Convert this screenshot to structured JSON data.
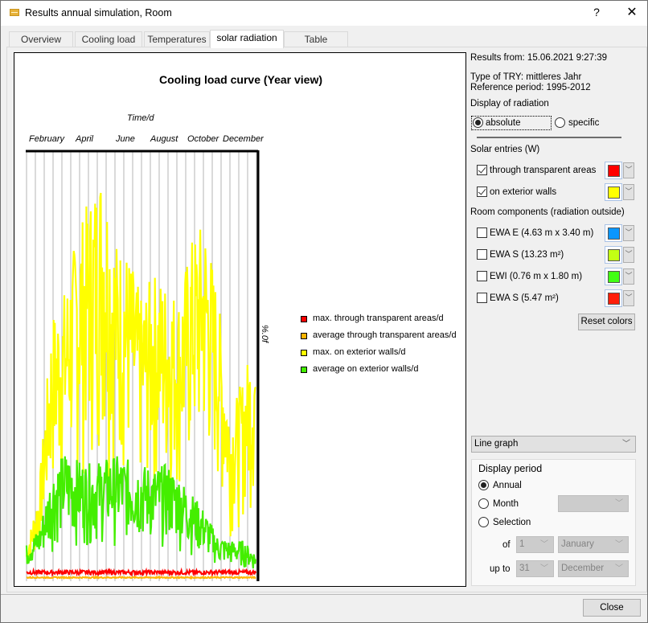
{
  "window": {
    "title": "Results annual simulation, Room",
    "help_label": "?",
    "close_label": "✕"
  },
  "tabs": [
    {
      "label": "Overview",
      "active": false
    },
    {
      "label": "Cooling load",
      "active": false
    },
    {
      "label": "Temperatures",
      "active": false
    },
    {
      "label": "solar radiation",
      "active": true
    },
    {
      "label": "Table",
      "active": false
    }
  ],
  "chart_data": {
    "type": "line",
    "title": "Cooling load curve (Year view)",
    "xlabel": "Time/d",
    "ylabel": "%.0f",
    "x_tick_labels": [
      "February",
      "April",
      "June",
      "August",
      "October",
      "December"
    ],
    "x_range_days": [
      1,
      365
    ],
    "grid": "vertical",
    "legend_position": "right",
    "y_axis_relative_max": 1.0,
    "series": [
      {
        "name": "max. through transparent areas/d",
        "color": "#ff0000",
        "level_relative": 0.015,
        "spread": 0.01
      },
      {
        "name": "average through transparent areas/d",
        "color": "#ffb400",
        "level_relative": 0.003,
        "spread": 0.003
      },
      {
        "name": "max. on exterior walls/d",
        "color": "#ffff00",
        "envelope_relative": [
          0.07,
          0.22,
          0.62,
          0.68,
          0.82,
          0.9,
          0.99,
          0.8,
          0.77,
          0.66,
          0.72,
          0.7,
          0.67,
          0.8,
          0.85,
          0.68,
          0.39,
          0.47,
          0.59
        ],
        "note": "daily max values, peaks in April (~99% of axis)"
      },
      {
        "name": "average on exterior walls/d",
        "color": "#44ee00",
        "envelope_relative": [
          0.08,
          0.12,
          0.25,
          0.3,
          0.28,
          0.27,
          0.28,
          0.29,
          0.28,
          0.27,
          0.26,
          0.27,
          0.24,
          0.2,
          0.16,
          0.1,
          0.09,
          0.09,
          0.06
        ],
        "note": "daily average values"
      }
    ]
  },
  "info": {
    "results_from": "Results from:  15.06.2021 9:27:39",
    "try_type": "Type of TRY: mittleres Jahr",
    "reference_period": "Reference period: 1995-2012",
    "display_label": "Display of radiation",
    "radio_absolute": "absolute",
    "radio_specific": "specific",
    "radio_selected": "absolute"
  },
  "solar_entries": {
    "heading": "Solar entries (W)",
    "items": [
      {
        "label": "through transparent areas",
        "checked": true,
        "color": "#ff0000"
      },
      {
        "label": "on exterior walls",
        "checked": true,
        "color": "#ffff00"
      }
    ]
  },
  "room_components": {
    "heading": "Room components (radiation outside)",
    "items": [
      {
        "label": "EWA E (4.63 m x 3.40 m)",
        "checked": false,
        "color": "#0a96ff"
      },
      {
        "label": "EWA S (13.23 m²)",
        "checked": false,
        "color": "#c3ff14"
      },
      {
        "label": "EWI (0.76 m x 1.80 m)",
        "checked": false,
        "color": "#41ff14"
      },
      {
        "label": "EWA S (5.47 m²)",
        "checked": false,
        "color": "#ff1e0a"
      }
    ],
    "reset_label": "Reset colors"
  },
  "graph_type": {
    "selected": "Line graph"
  },
  "display_period": {
    "heading": "Display period",
    "annual": "Annual",
    "month": "Month",
    "selection": "Selection",
    "selected": "annual",
    "month_value": "",
    "of_label": "of",
    "upto_label": "up to",
    "from_day": "1",
    "from_month": "January",
    "to_day": "31",
    "to_month": "December"
  },
  "footer": {
    "close_label": "Close"
  }
}
